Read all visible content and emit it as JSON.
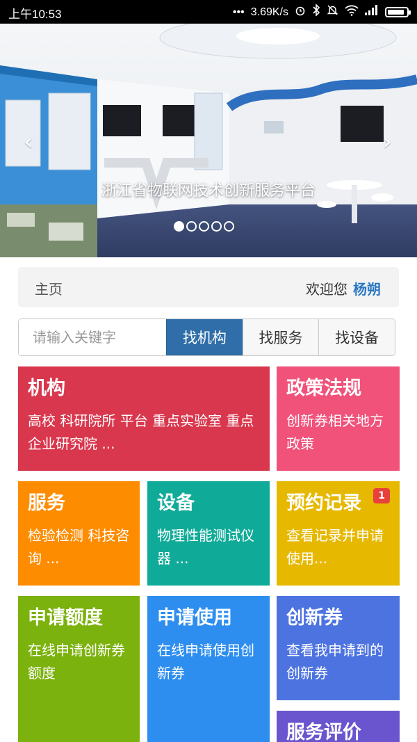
{
  "status_bar": {
    "time": "上午10:53",
    "dots": "•••",
    "network_speed": "3.69K/s",
    "icons": [
      "alarm-icon",
      "bluetooth-icon",
      "mute-icon",
      "wifi-icon",
      "signal-icon",
      "battery-icon"
    ],
    "battery_level": 0.9
  },
  "banner": {
    "caption": "浙江省物联网技术创新服务平台",
    "prev_glyph": "‹",
    "next_glyph": "›",
    "slide_count": 5,
    "active_index": 0
  },
  "breadcrumb": {
    "home": "主页",
    "welcome": "欢迎您",
    "username": "杨朔"
  },
  "search": {
    "placeholder": "请输入关键字",
    "value": "",
    "buttons": [
      "找机构",
      "找服务",
      "找设备"
    ],
    "active_button": 0
  },
  "tiles": [
    {
      "title": "机构",
      "desc": "高校 科研院所 平台 重点实验室 重点企业研究院 ...",
      "color": "#d9374d"
    },
    {
      "title": "政策法规",
      "desc": "创新券相关地方政策",
      "color": "#f0527a"
    },
    {
      "title": "服务",
      "desc": "检验检测 科技咨询 ...",
      "color": "#fd8c00"
    },
    {
      "title": "设备",
      "desc": "物理性能测试仪器 ...",
      "color": "#10ab98"
    },
    {
      "title": "预约记录",
      "desc": "查看记录并申请使用...",
      "color": "#e6b800",
      "badge": "1"
    },
    {
      "title": "申请额度",
      "desc": "在线申请创新券额度",
      "color": "#7cb20d"
    },
    {
      "title": "申请使用",
      "desc": "在线申请使用创新券",
      "color": "#2d8ef0"
    },
    {
      "title": "创新券",
      "desc": "查看我申请到的创新券",
      "color": "#4d73e1"
    },
    {
      "title": "服务评价",
      "desc": "",
      "color": "#6a55cf"
    }
  ]
}
